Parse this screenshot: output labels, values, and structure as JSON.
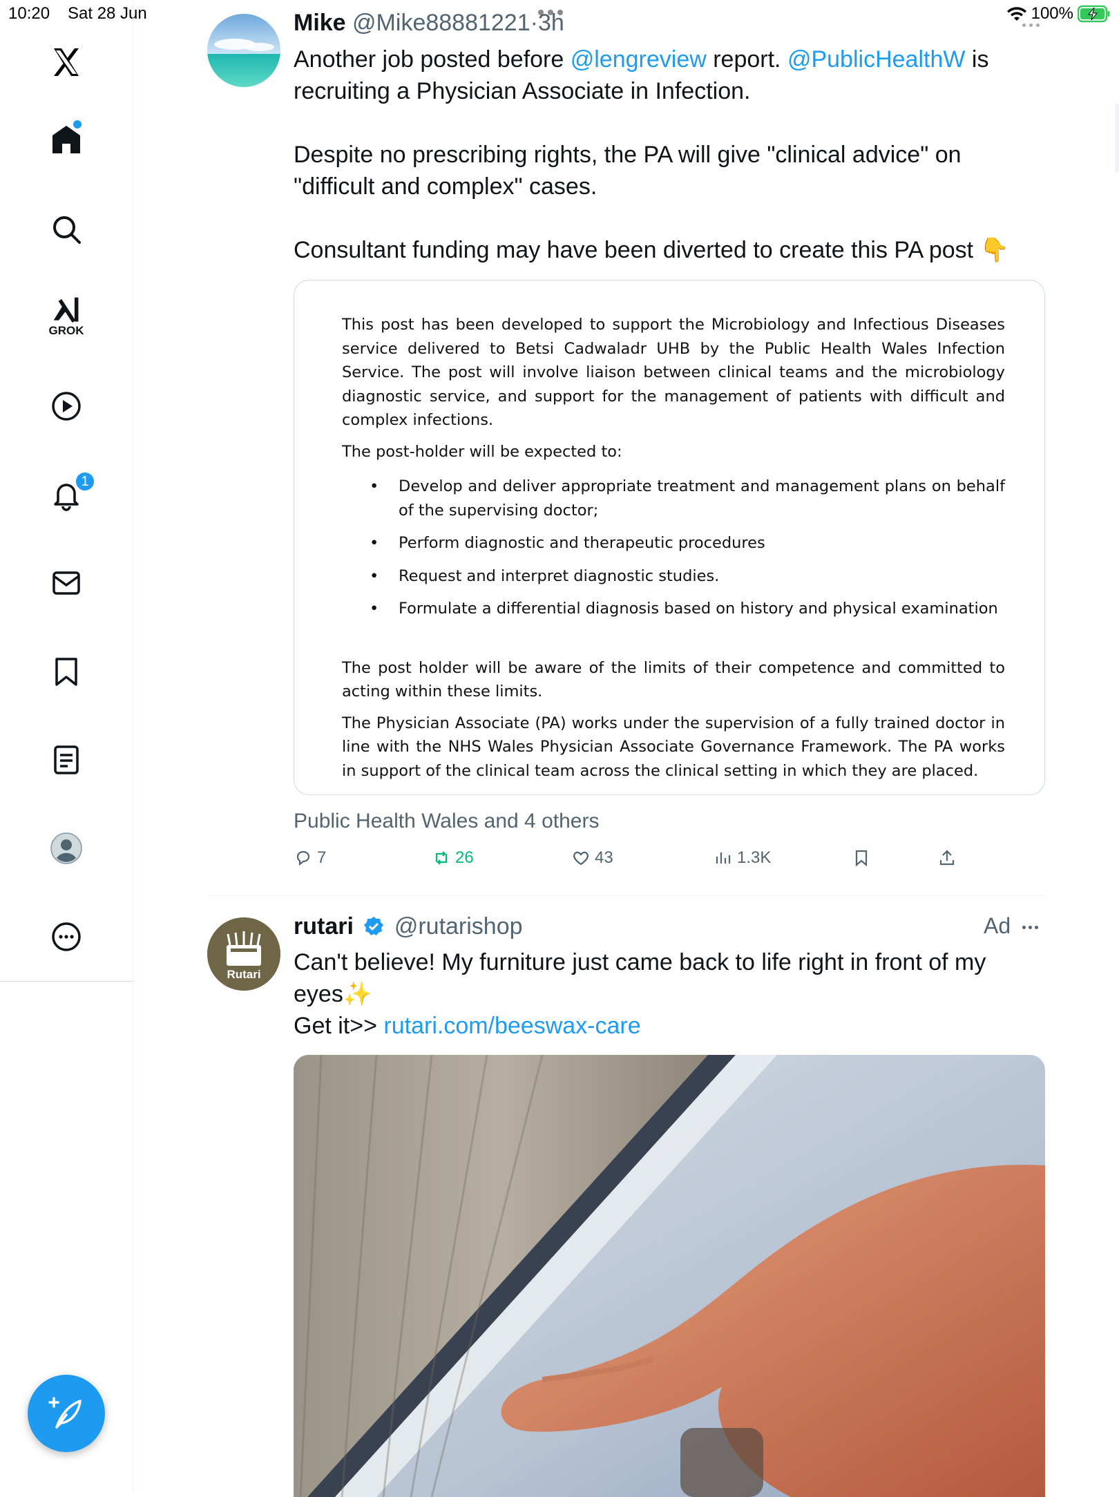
{
  "status_bar": {
    "time": "10:20",
    "date": "Sat 28 Jun",
    "battery": "100%"
  },
  "sidebar": {
    "items": [
      {
        "id": "x-logo"
      },
      {
        "id": "home"
      },
      {
        "id": "search"
      },
      {
        "id": "grok",
        "label": "GROK"
      },
      {
        "id": "video"
      },
      {
        "id": "notifications",
        "badge": "1"
      },
      {
        "id": "messages"
      },
      {
        "id": "bookmarks"
      },
      {
        "id": "lists"
      },
      {
        "id": "profile"
      },
      {
        "id": "more"
      }
    ]
  },
  "tweet1": {
    "name": "Mike",
    "handle": "@Mike88881221",
    "dot": "·",
    "time": "3h",
    "line1_a": "Another job posted before ",
    "mention1": "@lengreview",
    "line1_b": " report. ",
    "mention2": "@PublicHealthW",
    "line1_c": " is",
    "line2": "recruiting a Physician Associate in Infection.",
    "para2_l1": "Despite no prescribing rights, the PA will give \"clinical advice\" on",
    "para2_l2": "\"difficult and complex\" cases.",
    "para3": "Consultant funding may have been diverted to create this PA post",
    "emoji": "👇",
    "doc": {
      "p1": "This post has been developed to support the Microbiology and Infectious Diseases service delivered to Betsi Cadwaladr UHB by the Public Health Wales Infection Service. The post will involve liaison between clinical teams and the microbiology diagnostic service, and support for the management of patients with difficult and complex infections.",
      "p2": "The post-holder will be expected to:",
      "bullets": [
        "Develop and deliver appropriate treatment and management plans on behalf of the supervising doctor;",
        "Perform diagnostic and therapeutic procedures",
        "Request and interpret diagnostic studies.",
        "Formulate a differential diagnosis based on history and physical examination"
      ],
      "p3": "The post holder will be aware of the limits of their competence and committed to acting within these limits.",
      "p4": "The Physician Associate (PA) works under the supervision of a fully trained doctor in line with the NHS Wales Physician Associate Governance Framework. The PA works in support of the clinical team across the clinical setting in which they are placed."
    },
    "tagged": "Public Health Wales and 4 others",
    "replies": "7",
    "reposts": "26",
    "likes": "43",
    "views": "1.3K"
  },
  "tweet2": {
    "name": "rutari",
    "handle": "@rutarishop",
    "ad_label": "Ad",
    "avatar_text": "Rutari",
    "line1": "Can't believe! My furniture just came back to life right in front of my",
    "line2": "eyes",
    "sparkle": "✨",
    "line3_prefix": "Get it>> ",
    "link": "rutari.com/beeswax-care"
  },
  "colors": {
    "accent": "#1d9bf0",
    "repost_green": "#00ba7c",
    "secondary": "#536471"
  }
}
